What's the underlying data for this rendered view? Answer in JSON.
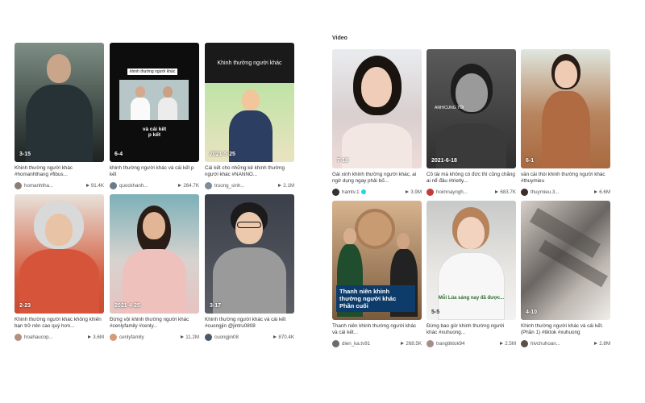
{
  "section_title": "Video",
  "left_cards": [
    {
      "date": "3-15",
      "caption": "Khinh thường người khác #homanhthang #fibus...",
      "author": "homanhtha...",
      "views": "91.4K",
      "verified": false
    },
    {
      "date": "6-4",
      "caption": "khinh thường người khác và cái kết p kết",
      "author": "quockhanh...",
      "views": "264.7K",
      "verified": false,
      "overlay_top": "khinh thường người khác",
      "overlay_bottom": "và cái kết\np kết"
    },
    {
      "date": "2021-5-25",
      "caption": "Cái kết cho những kẻ khinh thường người khác #NANNO...",
      "author": "truong_sinh...",
      "views": "2.1M",
      "verified": false,
      "overlay_top": "Khinh thường người khác"
    },
    {
      "date": "2-23",
      "caption": "Khinh thường người khác không khiến bạn trở nên cao quý hơn...",
      "author": "hoahaucop...",
      "views": "3.6M",
      "verified": false
    },
    {
      "date": "2021-4-25",
      "caption": "Đừng vội khinh thường người khác #cenlyfamily #cenly...",
      "author": "cenlyfamily",
      "views": "11.2M",
      "verified": false
    },
    {
      "date": "3-17",
      "caption": "Khinh thường người khác và cái kết #cuongjin @jintru0808",
      "author": "cuongjin08",
      "views": "870.4K",
      "verified": false
    }
  ],
  "right_cards": [
    {
      "date": "7-18",
      "caption": "Gái xinh khinh thường người khác, ai ngờ dụng ngay phải bố...",
      "author": "hamtv.1",
      "views": "3.9M",
      "verified": true
    },
    {
      "date": "2021-6-18",
      "caption": "Cô tài mà không có đức thì cũng chẳng ai nể đâu #trietly...",
      "author": "hoimnayngh...",
      "views": "683.7K",
      "verified": false,
      "overlay_top": "ANH/CUNG TÔI"
    },
    {
      "date": "6-1",
      "caption": "vẫn cái thói khinh thường người khác #thuymieu",
      "author": "thuymieu.3...",
      "views": "6.6M",
      "verified": false
    },
    {
      "date": "",
      "caption": "Thanh niên khinh thường người khác và cái kết...",
      "author": "dien_ka.tv91",
      "views": "268.5K",
      "verified": false,
      "banner": "Thanh niên khinh thường người khác Phần cuối"
    },
    {
      "date": "5-5",
      "caption": "Đừng bao giờ khinh thường người khác #xuhuong...",
      "author": "trangtiktok94",
      "views": "2.5M",
      "verified": false,
      "overlay_top": "Mỗi Lúa sáng nay đã được..."
    },
    {
      "date": "4-10",
      "caption": "Khinh thường người khác và cái kết. (Phần 1) #tiktok #xuhuong",
      "author": "hlvchuhoan...",
      "views": "2.8M",
      "verified": false
    }
  ],
  "colors": {
    "accent": "#20d5ec",
    "banner": "#0d3c6b"
  }
}
